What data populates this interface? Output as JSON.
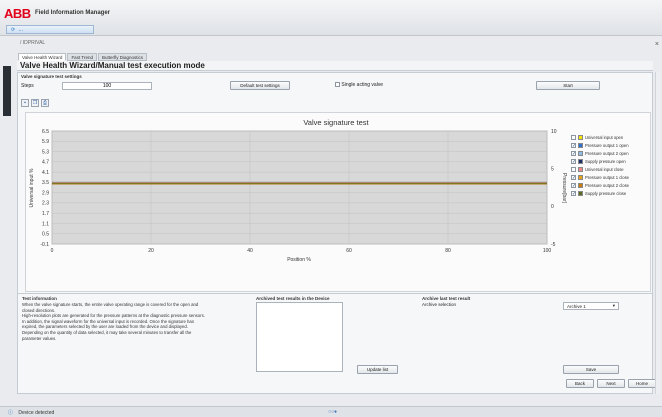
{
  "app": {
    "brand": "ABB",
    "title": "Field Information Manager",
    "device_tab": "…"
  },
  "breadcrumb": "/ IDPRIVAL",
  "tabs": [
    {
      "label": "Valve Health Wizard"
    },
    {
      "label": "Fast Trend"
    },
    {
      "label": "Butterfly Diagnostics"
    }
  ],
  "page_title": "Valve Health Wizard/Manual test execution mode",
  "settings": {
    "section_title": "Valve signature test settings",
    "steps_label": "Steps",
    "steps_value": "100",
    "default_button": "Default test settings",
    "single_acting_label": "Single acting valve",
    "start_button": "Start"
  },
  "toolbar": {
    "icons": [
      "save-icon",
      "copy-icon",
      "print-icon"
    ]
  },
  "chart_data": {
    "type": "line",
    "title": "Valve signature test",
    "xlabel": "Position %",
    "ylabel": "Universal input %",
    "y2label": "Pressure[bar]",
    "xlim": [
      0,
      100
    ],
    "ylim": [
      -0.1,
      6.5
    ],
    "y2lim": [
      -5,
      10
    ],
    "x_ticks": [
      "0",
      "20",
      "40",
      "60",
      "80",
      "100"
    ],
    "y_ticks": [
      "6.5",
      "5.9",
      "5.3",
      "4.7",
      "4.1",
      "3.5",
      "2.9",
      "2.3",
      "1.7",
      "1.1",
      "0.5",
      "-0.1"
    ],
    "y2_ticks": [
      "10",
      "5",
      "0",
      "-5"
    ],
    "series": [
      {
        "name": "Universal input open",
        "color": "#f5e600",
        "checked": false,
        "axis": "y",
        "x": [
          0,
          100
        ],
        "y": [
          3.5,
          3.5
        ]
      },
      {
        "name": "Pressure output 1 open",
        "color": "#2e6fd1",
        "checked": true,
        "axis": "y",
        "x": [
          0,
          100
        ],
        "y": [
          3.5,
          3.5
        ]
      },
      {
        "name": "Pressure output 2 open",
        "color": "#8fbce6",
        "checked": true,
        "axis": "y",
        "x": [
          0,
          100
        ],
        "y": [
          3.4,
          3.4
        ]
      },
      {
        "name": "Supply pressure open",
        "color": "#1b2f6b",
        "checked": true,
        "axis": "y",
        "x": [
          0,
          100
        ],
        "y": [
          3.45,
          3.45
        ]
      },
      {
        "name": "Universal input close",
        "color": "#f08a8a",
        "checked": false,
        "axis": "y",
        "x": [
          0,
          100
        ],
        "y": [
          3.5,
          3.5
        ]
      },
      {
        "name": "Pressure output 1 close",
        "color": "#e8a317",
        "checked": true,
        "axis": "y",
        "x": [
          0,
          100
        ],
        "y": [
          3.45,
          3.45
        ]
      },
      {
        "name": "Pressure output 2 close",
        "color": "#c87d0e",
        "checked": true,
        "axis": "y",
        "x": [
          0,
          100
        ],
        "y": [
          3.4,
          3.4
        ]
      },
      {
        "name": "Supply pressure close",
        "color": "#5b6b1f",
        "checked": true,
        "axis": "y",
        "x": [
          0,
          100
        ],
        "y": [
          3.42,
          3.42
        ]
      }
    ]
  },
  "info": {
    "title": "Test information",
    "lines": [
      "When the valve signature starts, the entire valve operating range is covered for the open and",
      "closed directions.",
      "High-resolution plots are generated for the pressure patterns at the diagnostic pressure sensors.",
      "In addition, the signal waveform for the universal input is recorded. Once the signature has",
      "expired, the parameters selected by the user are loaded from the device and displayed.",
      "Depending on the quantity of data selected, it may take several minutes to transfer all the",
      "parameter values."
    ]
  },
  "archived": {
    "title": "Archived test results in the Device",
    "update_button": "Update list"
  },
  "archive_last": {
    "title": "Archive last test result",
    "selection_label": "Archive selection",
    "selection_value": "Archive 1",
    "save_button": "Save"
  },
  "nav": {
    "back": "Back",
    "next": "Next",
    "home": "Home"
  },
  "status": {
    "text": "Device detected",
    "dots": "○○●"
  }
}
